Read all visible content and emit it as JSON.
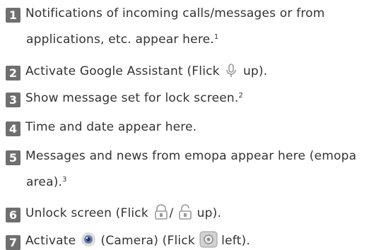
{
  "items": [
    {
      "num": "1",
      "line1": "Notifications of incoming calls/messages or from",
      "line2": "applications, etc. appear here.",
      "note": "1"
    },
    {
      "num": "2",
      "pre": "Activate Google Assistant (Flick",
      "post": "up)."
    },
    {
      "num": "3",
      "text": "Show message set for lock screen.",
      "note": "2"
    },
    {
      "num": "4",
      "text": "Time and date appear here."
    },
    {
      "num": "5",
      "line1": "Messages and news from emopa appear here (emopa",
      "line2": "area).",
      "note": "3"
    },
    {
      "num": "6",
      "pre": "Unlock screen (Flick",
      "sep": "/",
      "post": "up)."
    },
    {
      "num": "7",
      "pre": "Activate",
      "mid": "(Camera) (Flick",
      "post": "left)."
    }
  ],
  "colors": {
    "badge": "#6f6f6f",
    "text": "#333333"
  },
  "icons": [
    "microphone-icon",
    "lock-open-icon",
    "lock-icon",
    "camera-app-icon",
    "camera-button-icon"
  ]
}
